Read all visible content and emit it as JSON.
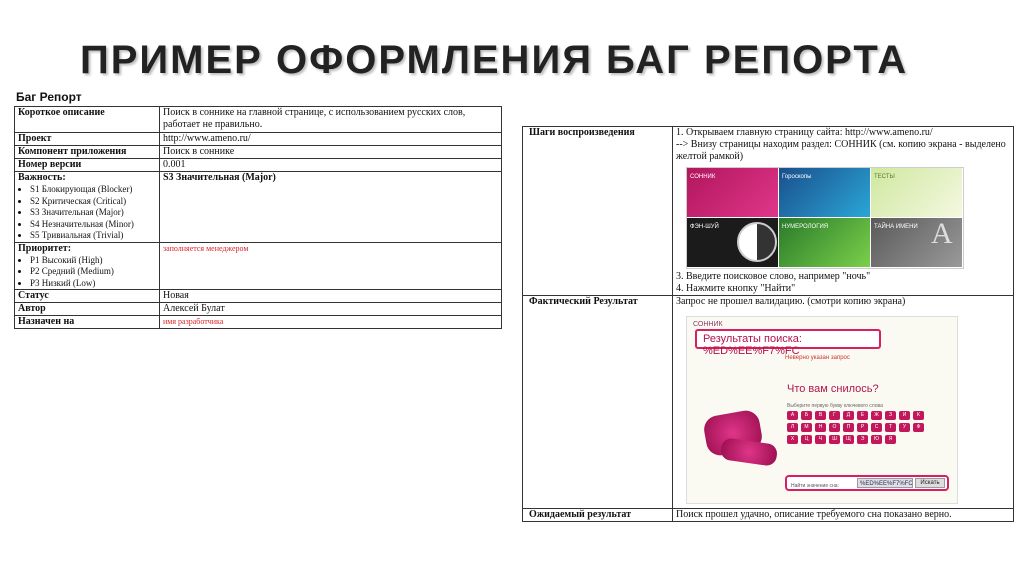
{
  "slide_title": "ПРИМЕР ОФОРМЛЕНИЯ БАГ РЕПОРТА",
  "report_title": "Баг Репорт",
  "left_table": {
    "short_desc_label": "Короткое описание",
    "short_desc_value": "Поиск в соннике на главной странице, с использованием русских слов, работает не правильно.",
    "project_label": "Проект",
    "project_value": "http://www.ameno.ru/",
    "component_label": "Компонент приложения",
    "component_value": "Поиск в соннике",
    "version_label": "Номер версии",
    "version_value": "0.001",
    "severity_label": "Важность:",
    "severity_options": [
      "S1 Блокирующая (Blocker)",
      "S2 Критическая (Critical)",
      "S3 Значительная (Major)",
      "S4 Незначительная (Minor)",
      "S5 Тривиальная (Trivial)"
    ],
    "severity_value": "S3 Значительная (Major)",
    "priority_label": "Приоритет:",
    "priority_options": [
      "P1 Высокий (High)",
      "P2 Средний (Medium)",
      "P3 Низкий (Low)"
    ],
    "priority_value": "заполняется менеджером",
    "status_label": "Статус",
    "status_value": "Новая",
    "author_label": "Автор",
    "author_value": "Алексей Булат",
    "assigned_label": "Назначен на",
    "assigned_value": "имя разработчика"
  },
  "right_table": {
    "steps_label": "Шаги воспроизведения",
    "step1": "1. Открываем главную страницу сайта: http://www.ameno.ru/",
    "step2": "--> Внизу страницы находим раздел: СОННИК (см. копию экрана - выделено желтой рамкой)",
    "tiles": [
      "СОННИК",
      "Гороскопы",
      "ТЕСТЫ",
      "ФЭН-ШУЙ",
      "НУМЕРОЛОГИЯ",
      "ТАЙНА ИМЕНИ"
    ],
    "step3": "3. Введите поисковое слово, например \"ночь\"",
    "step4": "4. Нажмите кнопку \"Найти\"",
    "actual_label": "Фактический Результат",
    "actual_value": "Запрос не прошел валидацию. (смотри копию экрана)",
    "shot": {
      "brand": "СОННИК",
      "results_text": "Результаты поиска: %ED%EE%F7%FC",
      "sub_text": "Неверно указан запрос",
      "question": "Что вам снилось?",
      "hint": "Выберите первую букву ключевого слова",
      "letters": [
        "А",
        "Б",
        "В",
        "Г",
        "Д",
        "Е",
        "Ж",
        "З",
        "И",
        "К",
        "Л",
        "М",
        "Н",
        "О",
        "П",
        "Р",
        "С",
        "Т",
        "У",
        "Ф",
        "Х",
        "Ц",
        "Ч",
        "Ш",
        "Щ",
        "Э",
        "Ю",
        "Я"
      ],
      "search_label": "Найти значение сна:",
      "search_value": "%ED%EE%F7%FC",
      "search_button": "Искать"
    },
    "expected_label": "Ожидаемый результат",
    "expected_value": "Поиск прошел удачно, описание требуемого сна показано верно."
  }
}
